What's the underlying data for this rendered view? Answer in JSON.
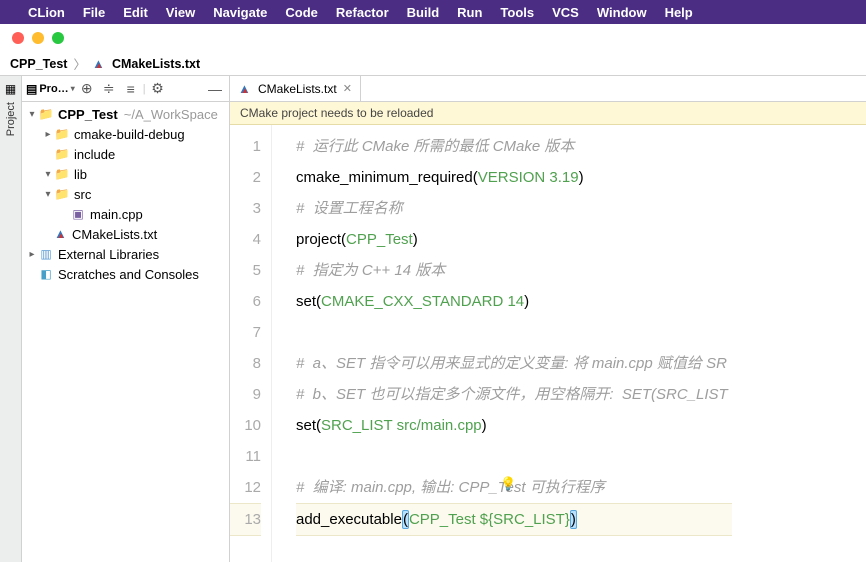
{
  "menubar": {
    "app": "CLion",
    "items": [
      "File",
      "Edit",
      "View",
      "Navigate",
      "Code",
      "Refactor",
      "Build",
      "Run",
      "Tools",
      "VCS",
      "Window",
      "Help"
    ]
  },
  "breadcrumb": {
    "root": "CPP_Test",
    "file": "CMakeLists.txt"
  },
  "sidebar": {
    "toolwindow_label": "Project",
    "selector_label": "Pro…",
    "tree": {
      "root": {
        "name": "CPP_Test",
        "path_suffix": "~/A_WorkSpace"
      },
      "children": [
        {
          "name": "cmake-build-debug",
          "expanded": false,
          "kind": "folder-orange"
        },
        {
          "name": "include",
          "expanded": false,
          "kind": "folder"
        },
        {
          "name": "lib",
          "expanded": true,
          "kind": "folder"
        },
        {
          "name": "src",
          "expanded": true,
          "kind": "folder",
          "children": [
            {
              "name": "main.cpp",
              "kind": "cpp"
            }
          ]
        },
        {
          "name": "CMakeLists.txt",
          "kind": "cmake"
        }
      ],
      "extra": [
        {
          "name": "External Libraries"
        },
        {
          "name": "Scratches and Consoles"
        }
      ]
    }
  },
  "editor": {
    "tab_label": "CMakeLists.txt",
    "banner": "CMake project needs to be reloaded",
    "lines": [
      {
        "n": 1,
        "segs": [
          {
            "t": "#  运行此 CMake 所需的最低 CMake 版本",
            "c": "cm-comment"
          }
        ]
      },
      {
        "n": 2,
        "segs": [
          {
            "t": "cmake_minimum_required",
            "c": "cm-fn"
          },
          {
            "t": "(",
            "c": ""
          },
          {
            "t": "VERSION 3.19",
            "c": "cm-id"
          },
          {
            "t": ")",
            "c": ""
          }
        ]
      },
      {
        "n": 3,
        "segs": [
          {
            "t": "#  设置工程名称",
            "c": "cm-comment"
          }
        ]
      },
      {
        "n": 4,
        "segs": [
          {
            "t": "project",
            "c": "cm-fn"
          },
          {
            "t": "(",
            "c": ""
          },
          {
            "t": "CPP_Test",
            "c": "cm-id"
          },
          {
            "t": ")",
            "c": ""
          }
        ]
      },
      {
        "n": 5,
        "segs": [
          {
            "t": "#  指定为 C++ 14 版本",
            "c": "cm-comment"
          }
        ]
      },
      {
        "n": 6,
        "segs": [
          {
            "t": "set",
            "c": "cm-fn"
          },
          {
            "t": "(",
            "c": ""
          },
          {
            "t": "CMAKE_CXX_STANDARD 14",
            "c": "cm-id"
          },
          {
            "t": ")",
            "c": ""
          }
        ]
      },
      {
        "n": 7,
        "segs": [
          {
            "t": "",
            "c": ""
          }
        ]
      },
      {
        "n": 8,
        "segs": [
          {
            "t": "#  a、SET 指令可以用来显式的定义变量: 将 main.cpp 赋值给 SR",
            "c": "cm-comment"
          }
        ]
      },
      {
        "n": 9,
        "segs": [
          {
            "t": "#  b、SET 也可以指定多个源文件，用空格隔开:  SET(SRC_LIST ",
            "c": "cm-comment"
          }
        ]
      },
      {
        "n": 10,
        "segs": [
          {
            "t": "set",
            "c": "cm-fn"
          },
          {
            "t": "(",
            "c": ""
          },
          {
            "t": "SRC_LIST src/main.cpp",
            "c": "cm-id"
          },
          {
            "t": ")",
            "c": ""
          }
        ]
      },
      {
        "n": 11,
        "segs": [
          {
            "t": "",
            "c": ""
          }
        ]
      },
      {
        "n": 12,
        "segs": [
          {
            "t": "#  编译: main.cpp, 输出: CPP_Test 可执行程序",
            "c": "cm-comment"
          }
        ]
      },
      {
        "n": 13,
        "current": true,
        "segs": [
          {
            "t": "add_executable",
            "c": "cm-fn"
          },
          {
            "t": "(",
            "c": "cm-brace-match"
          },
          {
            "t": "CPP_Test ${SRC_LIST}",
            "c": "cm-id"
          },
          {
            "t": ")",
            "c": "cm-brace-match"
          }
        ]
      }
    ]
  }
}
